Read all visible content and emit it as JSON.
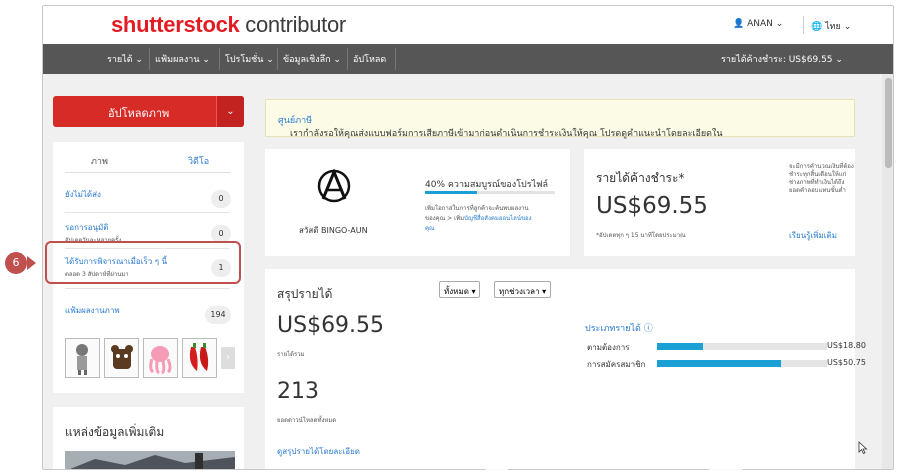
{
  "header": {
    "logo_bold": "shutterst",
    "logo_o": "o",
    "logo_ck": "ck",
    "logo_rest": " contributor",
    "user": "ANAN",
    "user_caret": "⌄",
    "lang": "ไทย",
    "lang_caret": "⌄"
  },
  "nav": {
    "items": [
      {
        "label": "รายได้ ⌄"
      },
      {
        "label": "แฟ้มผลงาน ⌄"
      },
      {
        "label": "โปรโมชั่น ⌄"
      },
      {
        "label": "ข้อมูลเชิงลึก ⌄"
      },
      {
        "label": "อัปโหลด"
      }
    ],
    "earnings": "รายได้ค้างชำระ: US$69.55 ⌄"
  },
  "upload": {
    "label": "อัปโหลดภาพ",
    "caret": "⌄"
  },
  "left": {
    "tabs": [
      {
        "label": "ภาพ",
        "active": true
      },
      {
        "label": "วิดีโอ",
        "active": false
      }
    ],
    "rows": [
      {
        "title": "ยังไม่ได้ส่ง",
        "sub": "",
        "count": "0"
      },
      {
        "title": "รอการอนุมัติ",
        "sub": "อัปเดตวันละหลายครั้ง",
        "count": "0"
      },
      {
        "title": "ได้รับการพิจารณาเมื่อเร็ว ๆ นี้",
        "sub": "ตลอด 3 สัปดาห์ที่ผ่านมา",
        "count": "1"
      },
      {
        "title": "แฟ้มผลงานภาพ",
        "sub": "",
        "count": "194"
      }
    ],
    "thumbs": [
      "illustration",
      "illustration",
      "illustration",
      "illustration"
    ],
    "more_title": "แหล่งข้อมูลเพิ่มเติม"
  },
  "annotation": {
    "step": "6"
  },
  "notice": {
    "text": "เรากำลังรอให้คุณส่งแบบฟอร์มการเสียภาษีเข้ามาก่อนดำเนินการชำระเงินให้คุณ โปรดดูคำแนะนำโดยละเอียดใน",
    "link": "ศูนย์ภาษี"
  },
  "profile": {
    "username": "สวัสดี BINGO-AUN",
    "completeness": "40% ความสมบูรณ์ของโปรไฟล์",
    "completeness_value": 40,
    "desc1": "เพิ่มโอกาสในการที่ลูกค้าจะค้นพบผลงาน",
    "desc2_plain": "ของคุณ > เพิ่ม",
    "desc2_link": "บัญชีสื่อสังคมออนไลน์ของ",
    "desc3_link": "คุณ"
  },
  "earnings": {
    "title": "รายได้ค้างชำระ*",
    "amount": "US$69.55",
    "note": "*อัปเดตทุก ๆ 15 นาทีโดยประมาณ",
    "side1": "จะมีการคำนวณเงินที่ต้อง",
    "side2": "ชำระทุกสิ้นเดือนให้แก่",
    "side3": "ช่างภาพที่ทำเงินได้ถึง",
    "side4": "ยอดคำลอบแทนขั้นต่ำ",
    "learn": "เรียนรู้เพิ่มเติม"
  },
  "summary": {
    "title": "สรุปรายได้",
    "filter_all": "ทั้งหมด ▾",
    "filter_time": "ทุกช่วงเวลา ▾",
    "total": "US$69.55",
    "total_label": "รายได้รวม",
    "downloads": "213",
    "downloads_label": "ยอดดาวน์โหลดทั้งหมด",
    "detail_link": "ดูสรุปรายได้โดยละเอียด",
    "type_title": "ประเภทรายได้ ⓘ",
    "types": [
      {
        "label": "ตามต้องการ",
        "amount": "US$18.80",
        "fraction": 0.27
      },
      {
        "label": "การสมัครสมาชิก",
        "amount": "US$50.75",
        "fraction": 0.73
      }
    ]
  }
}
